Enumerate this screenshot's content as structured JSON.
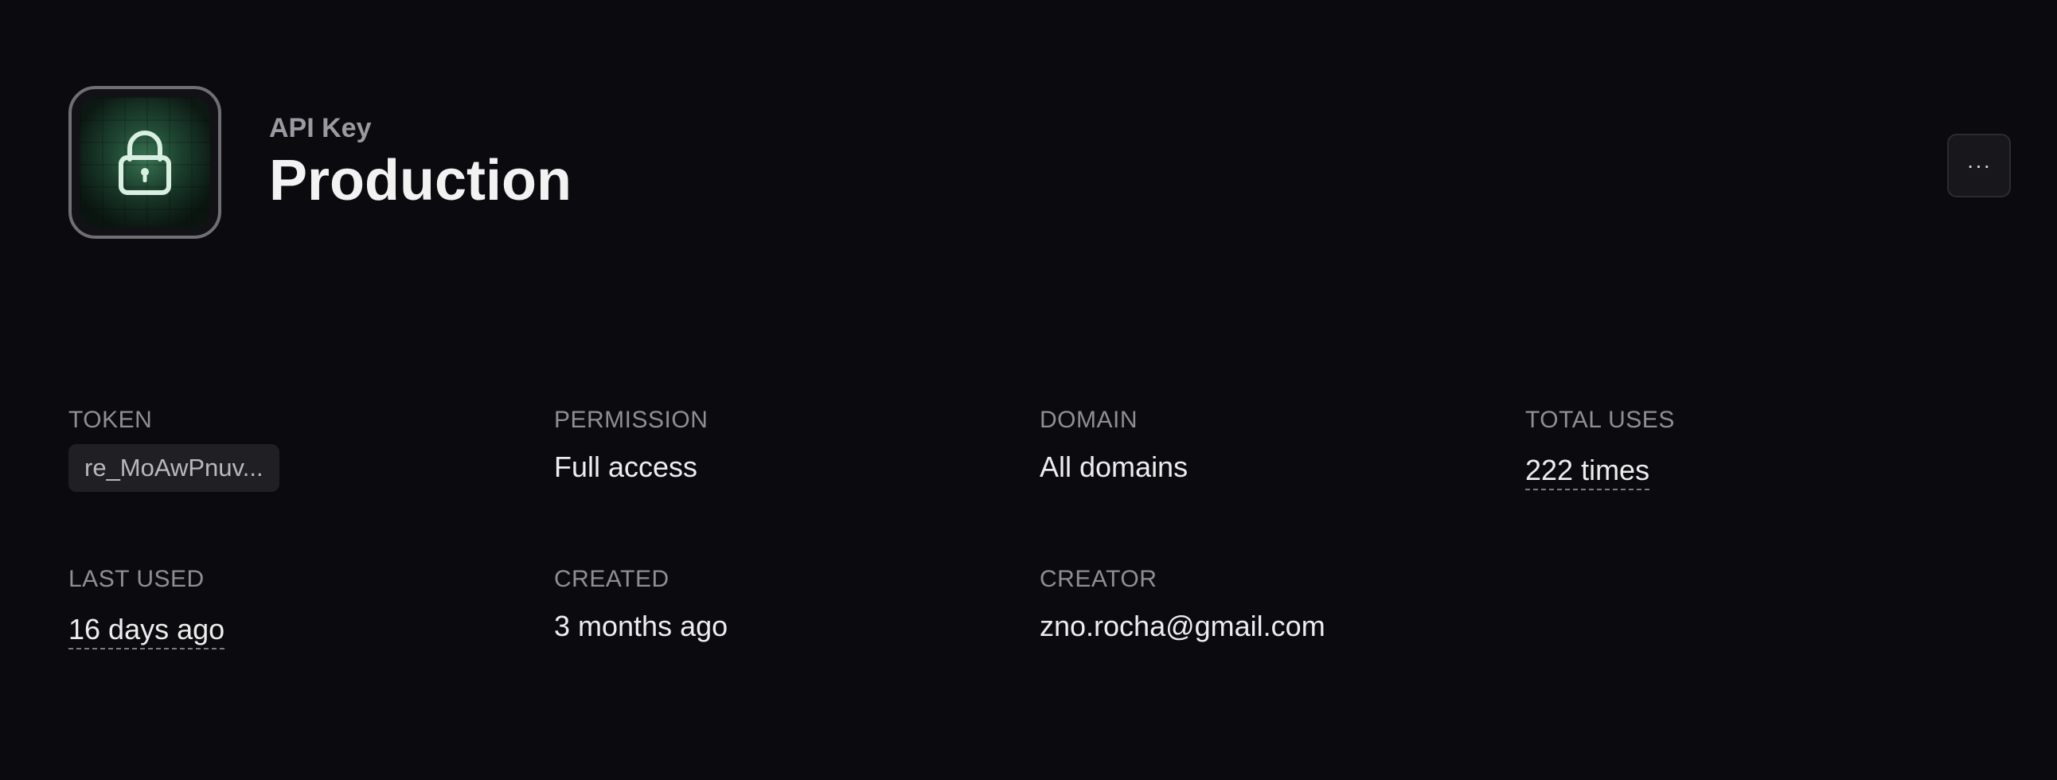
{
  "header": {
    "eyebrow": "API Key",
    "title": "Production",
    "icon": "lock-icon",
    "more_button_label": "···"
  },
  "details": {
    "token": {
      "label": "TOKEN",
      "value": "re_MoAwPnuv..."
    },
    "permission": {
      "label": "PERMISSION",
      "value": "Full access"
    },
    "domain": {
      "label": "DOMAIN",
      "value": "All domains"
    },
    "total_uses": {
      "label": "TOTAL USES",
      "value": "222 times"
    },
    "last_used": {
      "label": "LAST USED",
      "value": "16 days ago"
    },
    "created": {
      "label": "CREATED",
      "value": "3 months ago"
    },
    "creator": {
      "label": "CREATOR",
      "value": "zno.rocha@gmail.com"
    }
  },
  "colors": {
    "background": "#0b0b0f",
    "icon_accent": "#54aa78",
    "label": "#8e8e96",
    "value": "#ededed"
  }
}
